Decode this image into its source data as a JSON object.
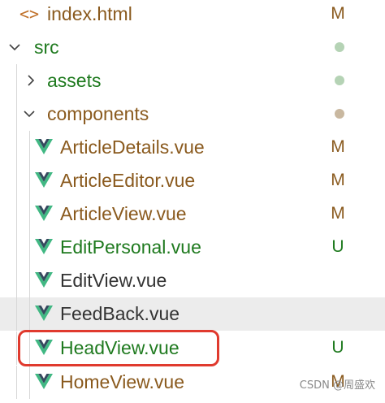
{
  "explorer": {
    "items": [
      {
        "label": "index.html",
        "status": "M",
        "type": "file-html"
      },
      {
        "label": "src",
        "status": "",
        "type": "folder-open",
        "dot": "green"
      },
      {
        "label": "assets",
        "status": "",
        "type": "folder-closed",
        "dot": "green"
      },
      {
        "label": "components",
        "status": "",
        "type": "folder-open",
        "dot": "tan"
      },
      {
        "label": "ArticleDetails.vue",
        "status": "M",
        "type": "file-vue"
      },
      {
        "label": "ArticleEditor.vue",
        "status": "M",
        "type": "file-vue"
      },
      {
        "label": "ArticleView.vue",
        "status": "M",
        "type": "file-vue"
      },
      {
        "label": "EditPersonal.vue",
        "status": "U",
        "type": "file-vue"
      },
      {
        "label": "EditView.vue",
        "status": "",
        "type": "file-vue"
      },
      {
        "label": "FeedBack.vue",
        "status": "",
        "type": "file-vue",
        "hovered": true
      },
      {
        "label": "HeadView.vue",
        "status": "U",
        "type": "file-vue",
        "highlighted": true
      },
      {
        "label": "HomeView.vue",
        "status": "M",
        "type": "file-vue"
      }
    ]
  },
  "colors": {
    "modified": "#8a5a1e",
    "untracked": "#1f7a1f",
    "default_text": "#333333",
    "vue_icon": "#41b883",
    "dot_green": "#b5d3b5",
    "dot_tan": "#c9b8a0",
    "highlight": "#e03a2e"
  },
  "watermark": "CSDN @周盛欢"
}
